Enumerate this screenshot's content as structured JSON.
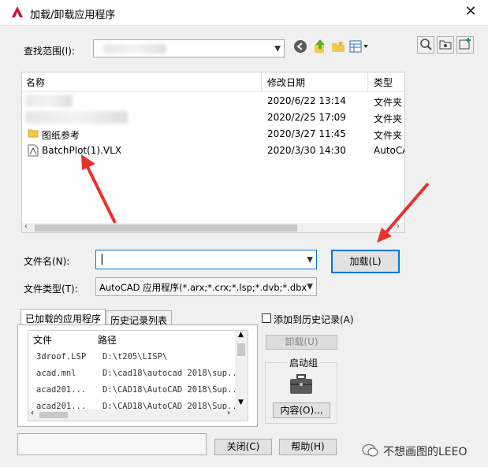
{
  "window": {
    "title": "加载/卸载应用程序",
    "close_glyph": "✕"
  },
  "lookin": {
    "label": "查找范围(I):"
  },
  "file_list": {
    "columns": [
      "名称",
      "修改日期",
      "类型"
    ],
    "rows": [
      {
        "name": "",
        "date": "2020/6/22 13:14",
        "type": "文件夹"
      },
      {
        "name": "",
        "date": "2020/2/25 17:09",
        "type": "文件夹"
      },
      {
        "name": "图纸参考",
        "date": "2020/3/27 11:45",
        "type": "文件夹"
      },
      {
        "name": "BatchPlot(1).VLX",
        "date": "2020/3/30 14:30",
        "type": "AutoCA"
      }
    ]
  },
  "filename": {
    "label": "文件名(N):",
    "value": ""
  },
  "filetype": {
    "label": "文件类型(T):",
    "value": "AutoCAD 应用程序(*.arx;*.crx;*.lsp;*.dvb;*.dbx"
  },
  "load_button": "加载(L)",
  "tabs": [
    "已加载的应用程序",
    "历史记录列表"
  ],
  "loaded_list": {
    "columns": [
      "文件",
      "路径"
    ],
    "rows": [
      {
        "file": "3droof.LSP",
        "path": "D:\\t205\\LISP\\"
      },
      {
        "file": "acad.mnl",
        "path": "D:\\cad18\\autocad 2018\\sup..."
      },
      {
        "file": "acad201...",
        "path": "D:\\CAD18\\AutoCAD 2018\\Sup..."
      },
      {
        "file": "acad201...",
        "path": "D:\\CAD18\\AutoCAD 2018\\Sup..."
      }
    ]
  },
  "add_history": {
    "label": "添加到历史记录(A)",
    "checked": false
  },
  "unload_button": "卸载(U)",
  "startup_group": {
    "title": "启动组",
    "contents_button": "内容(O)..."
  },
  "close_button": "关闭(C)",
  "help_button": "帮助(H)",
  "watermark": "不想画图的LEEO",
  "colors": {
    "accent": "#0078d7",
    "annotation_arrow": "#e8312a",
    "autocad_red": "#c8102e"
  }
}
